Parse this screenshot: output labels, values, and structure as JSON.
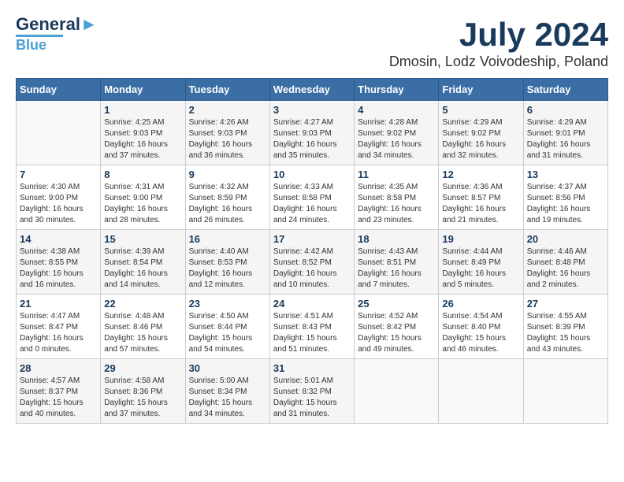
{
  "header": {
    "logo_general": "General",
    "logo_blue": "Blue",
    "month": "July 2024",
    "location": "Dmosin, Lodz Voivodeship, Poland"
  },
  "days_of_week": [
    "Sunday",
    "Monday",
    "Tuesday",
    "Wednesday",
    "Thursday",
    "Friday",
    "Saturday"
  ],
  "weeks": [
    [
      {
        "day": "",
        "info": ""
      },
      {
        "day": "1",
        "info": "Sunrise: 4:25 AM\nSunset: 9:03 PM\nDaylight: 16 hours\nand 37 minutes."
      },
      {
        "day": "2",
        "info": "Sunrise: 4:26 AM\nSunset: 9:03 PM\nDaylight: 16 hours\nand 36 minutes."
      },
      {
        "day": "3",
        "info": "Sunrise: 4:27 AM\nSunset: 9:03 PM\nDaylight: 16 hours\nand 35 minutes."
      },
      {
        "day": "4",
        "info": "Sunrise: 4:28 AM\nSunset: 9:02 PM\nDaylight: 16 hours\nand 34 minutes."
      },
      {
        "day": "5",
        "info": "Sunrise: 4:29 AM\nSunset: 9:02 PM\nDaylight: 16 hours\nand 32 minutes."
      },
      {
        "day": "6",
        "info": "Sunrise: 4:29 AM\nSunset: 9:01 PM\nDaylight: 16 hours\nand 31 minutes."
      }
    ],
    [
      {
        "day": "7",
        "info": "Sunrise: 4:30 AM\nSunset: 9:00 PM\nDaylight: 16 hours\nand 30 minutes."
      },
      {
        "day": "8",
        "info": "Sunrise: 4:31 AM\nSunset: 9:00 PM\nDaylight: 16 hours\nand 28 minutes."
      },
      {
        "day": "9",
        "info": "Sunrise: 4:32 AM\nSunset: 8:59 PM\nDaylight: 16 hours\nand 26 minutes."
      },
      {
        "day": "10",
        "info": "Sunrise: 4:33 AM\nSunset: 8:58 PM\nDaylight: 16 hours\nand 24 minutes."
      },
      {
        "day": "11",
        "info": "Sunrise: 4:35 AM\nSunset: 8:58 PM\nDaylight: 16 hours\nand 23 minutes."
      },
      {
        "day": "12",
        "info": "Sunrise: 4:36 AM\nSunset: 8:57 PM\nDaylight: 16 hours\nand 21 minutes."
      },
      {
        "day": "13",
        "info": "Sunrise: 4:37 AM\nSunset: 8:56 PM\nDaylight: 16 hours\nand 19 minutes."
      }
    ],
    [
      {
        "day": "14",
        "info": "Sunrise: 4:38 AM\nSunset: 8:55 PM\nDaylight: 16 hours\nand 16 minutes."
      },
      {
        "day": "15",
        "info": "Sunrise: 4:39 AM\nSunset: 8:54 PM\nDaylight: 16 hours\nand 14 minutes."
      },
      {
        "day": "16",
        "info": "Sunrise: 4:40 AM\nSunset: 8:53 PM\nDaylight: 16 hours\nand 12 minutes."
      },
      {
        "day": "17",
        "info": "Sunrise: 4:42 AM\nSunset: 8:52 PM\nDaylight: 16 hours\nand 10 minutes."
      },
      {
        "day": "18",
        "info": "Sunrise: 4:43 AM\nSunset: 8:51 PM\nDaylight: 16 hours\nand 7 minutes."
      },
      {
        "day": "19",
        "info": "Sunrise: 4:44 AM\nSunset: 8:49 PM\nDaylight: 16 hours\nand 5 minutes."
      },
      {
        "day": "20",
        "info": "Sunrise: 4:46 AM\nSunset: 8:48 PM\nDaylight: 16 hours\nand 2 minutes."
      }
    ],
    [
      {
        "day": "21",
        "info": "Sunrise: 4:47 AM\nSunset: 8:47 PM\nDaylight: 16 hours\nand 0 minutes."
      },
      {
        "day": "22",
        "info": "Sunrise: 4:48 AM\nSunset: 8:46 PM\nDaylight: 15 hours\nand 57 minutes."
      },
      {
        "day": "23",
        "info": "Sunrise: 4:50 AM\nSunset: 8:44 PM\nDaylight: 15 hours\nand 54 minutes."
      },
      {
        "day": "24",
        "info": "Sunrise: 4:51 AM\nSunset: 8:43 PM\nDaylight: 15 hours\nand 51 minutes."
      },
      {
        "day": "25",
        "info": "Sunrise: 4:52 AM\nSunset: 8:42 PM\nDaylight: 15 hours\nand 49 minutes."
      },
      {
        "day": "26",
        "info": "Sunrise: 4:54 AM\nSunset: 8:40 PM\nDaylight: 15 hours\nand 46 minutes."
      },
      {
        "day": "27",
        "info": "Sunrise: 4:55 AM\nSunset: 8:39 PM\nDaylight: 15 hours\nand 43 minutes."
      }
    ],
    [
      {
        "day": "28",
        "info": "Sunrise: 4:57 AM\nSunset: 8:37 PM\nDaylight: 15 hours\nand 40 minutes."
      },
      {
        "day": "29",
        "info": "Sunrise: 4:58 AM\nSunset: 8:36 PM\nDaylight: 15 hours\nand 37 minutes."
      },
      {
        "day": "30",
        "info": "Sunrise: 5:00 AM\nSunset: 8:34 PM\nDaylight: 15 hours\nand 34 minutes."
      },
      {
        "day": "31",
        "info": "Sunrise: 5:01 AM\nSunset: 8:32 PM\nDaylight: 15 hours\nand 31 minutes."
      },
      {
        "day": "",
        "info": ""
      },
      {
        "day": "",
        "info": ""
      },
      {
        "day": "",
        "info": ""
      }
    ]
  ]
}
